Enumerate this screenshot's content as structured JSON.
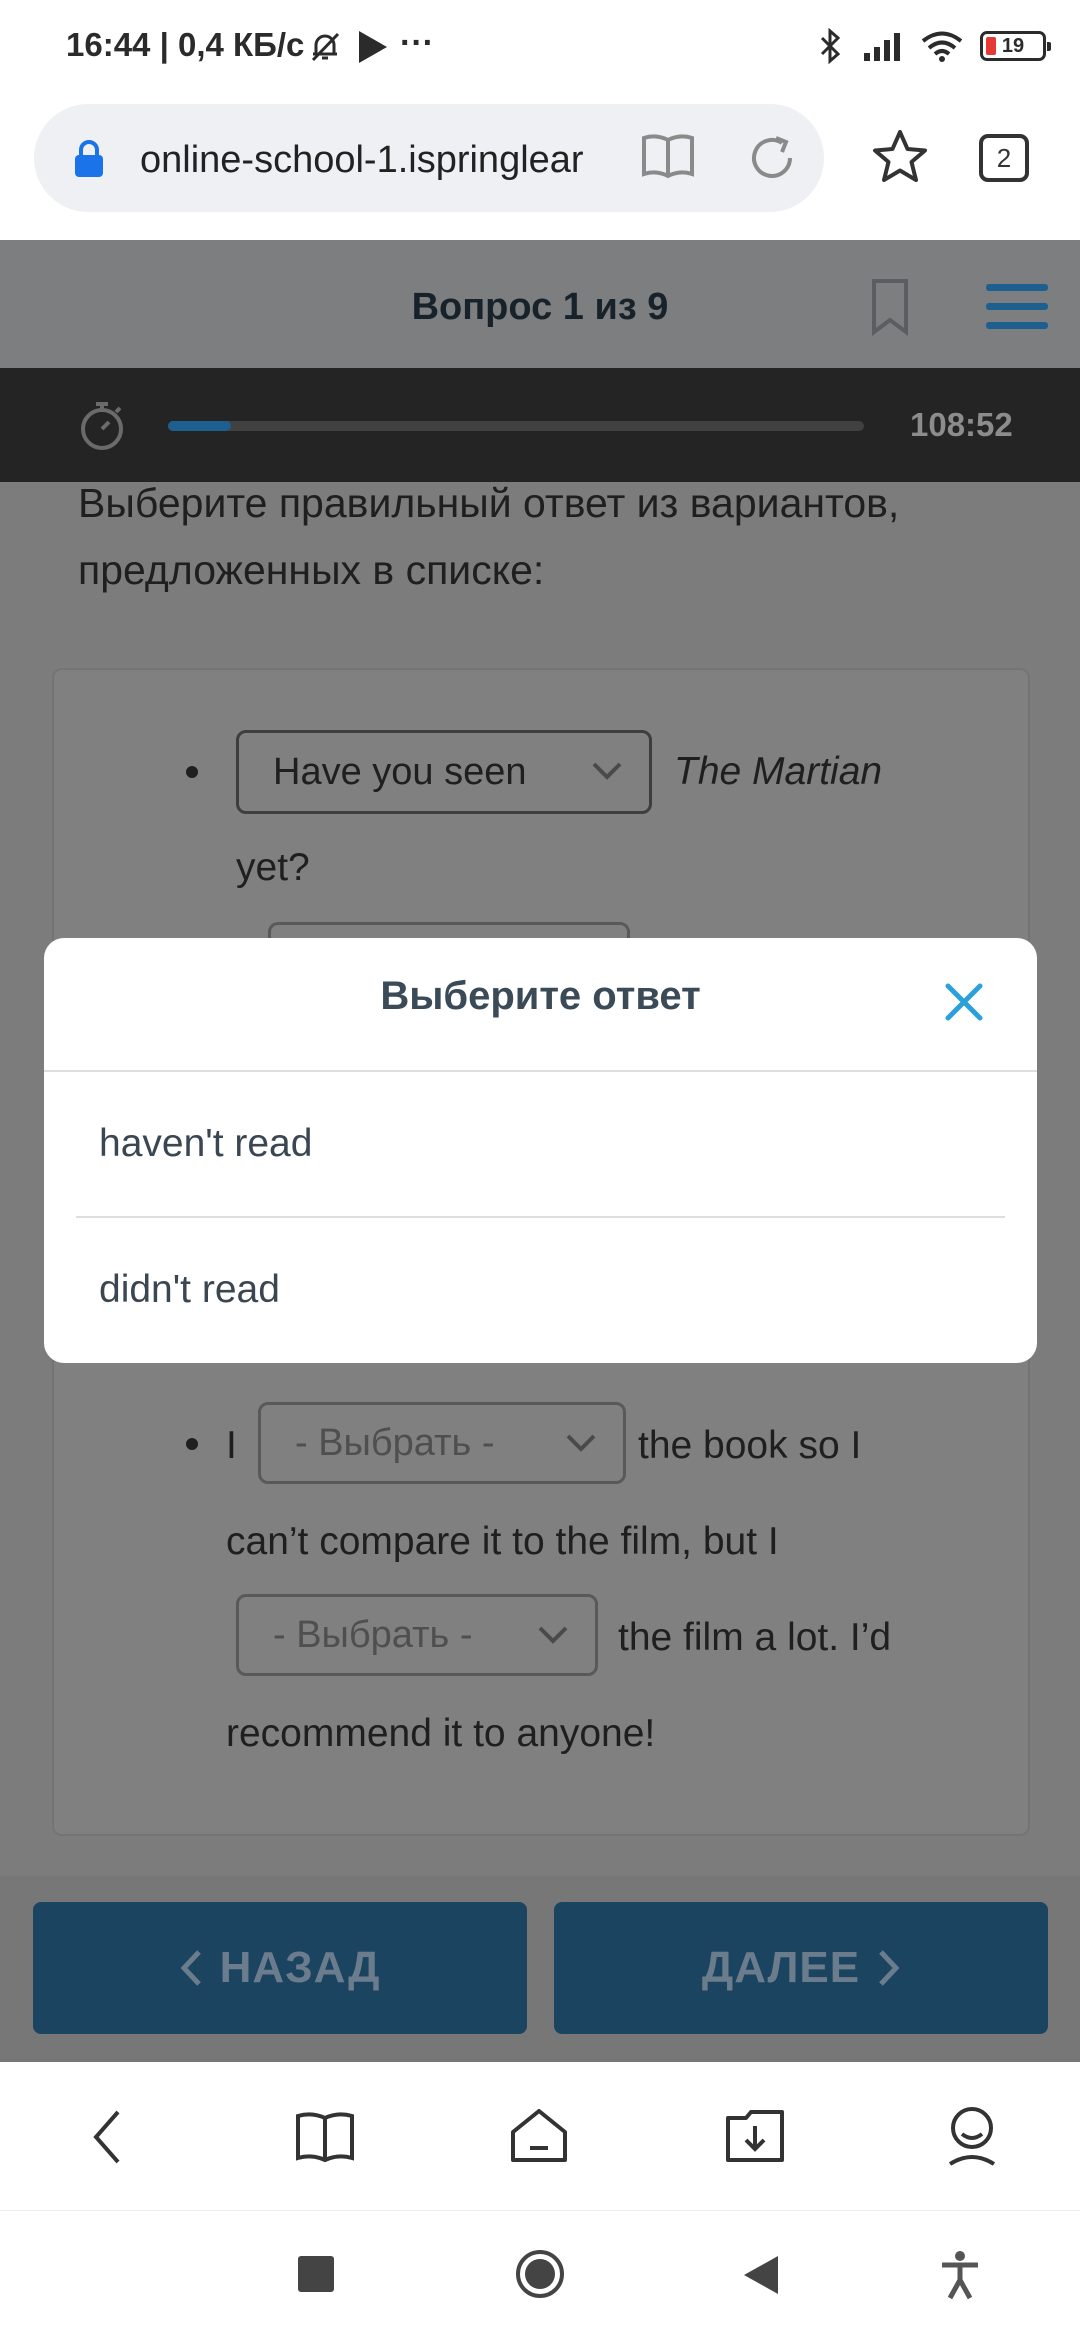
{
  "status_bar": {
    "text": "16:44 | 0,4 КБ/с",
    "battery": "19"
  },
  "browser": {
    "url": "online-school-1.ispringlear",
    "tab_count": "2"
  },
  "quiz": {
    "question_counter": "Вопрос 1 из 9",
    "timer": "108:52",
    "progress": 0.09,
    "instruction": "Выберите правильный ответ из вариантов, предложенных в списке:",
    "item1": {
      "select_value": "Have you seen",
      "title": "The Martian",
      "after": "yet?"
    },
    "item2": {
      "word": "I",
      "select1_placeholder": "- Выбрать -",
      "after1": "the book so I",
      "line2": "can’t compare it to the film, but I",
      "select2_placeholder": "- Выбрать -",
      "after2": "the film a lot. I’d",
      "line4": "recommend it to anyone!"
    }
  },
  "nav": {
    "back_label": "НАЗАД",
    "next_label": "ДАЛЕЕ"
  },
  "modal": {
    "title": "Выберите ответ",
    "options": [
      "haven't read",
      "didn't read"
    ]
  },
  "colors": {
    "accent": "#2aa1db",
    "button": "#1b4460",
    "header": "#7d7e80"
  }
}
